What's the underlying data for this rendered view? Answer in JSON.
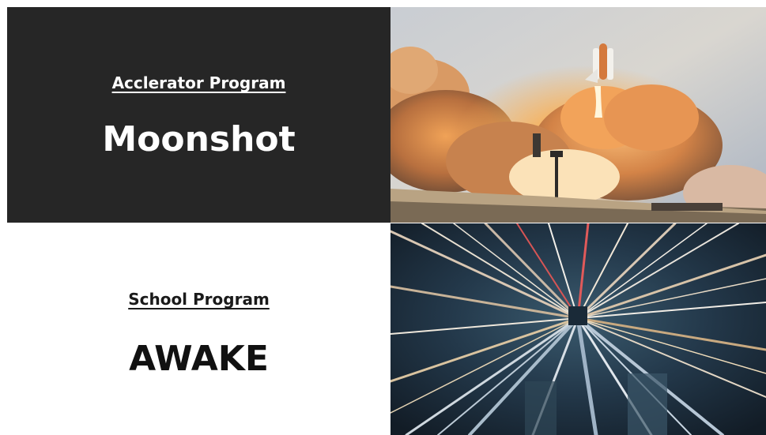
{
  "moonshot": {
    "subtitle": "Acclerator Program",
    "title": "Moonshot",
    "image": "rocket-launch-photo"
  },
  "awake": {
    "subtitle": "School Program",
    "title": "AWAKE",
    "image": "city-zoom-light-photo"
  },
  "colors": {
    "dark_panel": "#262626",
    "light_panel": "#ffffff",
    "dark_text": "#ffffff",
    "light_text": "#111111"
  }
}
